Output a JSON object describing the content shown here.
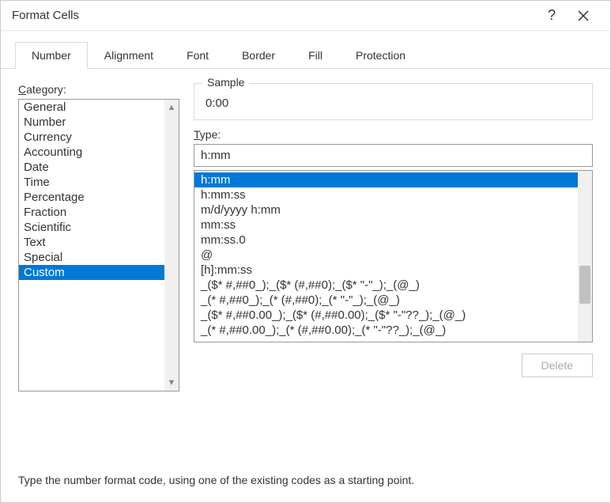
{
  "titlebar": {
    "title": "Format Cells",
    "help": "?"
  },
  "tabs": [
    {
      "label": "Number",
      "active": true
    },
    {
      "label": "Alignment",
      "active": false
    },
    {
      "label": "Font",
      "active": false
    },
    {
      "label": "Border",
      "active": false
    },
    {
      "label": "Fill",
      "active": false
    },
    {
      "label": "Protection",
      "active": false
    }
  ],
  "category": {
    "label_pre": "C",
    "label_post": "ategory:",
    "items": [
      {
        "label": "General",
        "selected": false
      },
      {
        "label": "Number",
        "selected": false
      },
      {
        "label": "Currency",
        "selected": false
      },
      {
        "label": "Accounting",
        "selected": false
      },
      {
        "label": "Date",
        "selected": false
      },
      {
        "label": "Time",
        "selected": false
      },
      {
        "label": "Percentage",
        "selected": false
      },
      {
        "label": "Fraction",
        "selected": false
      },
      {
        "label": "Scientific",
        "selected": false
      },
      {
        "label": "Text",
        "selected": false
      },
      {
        "label": "Special",
        "selected": false
      },
      {
        "label": "Custom",
        "selected": true
      }
    ]
  },
  "sample": {
    "label": "Sample",
    "value": "0:00"
  },
  "type": {
    "label_pre": "T",
    "label_post": "ype:",
    "value": "h:mm",
    "items": [
      {
        "label": "h:mm",
        "selected": true
      },
      {
        "label": "h:mm:ss",
        "selected": false
      },
      {
        "label": "m/d/yyyy h:mm",
        "selected": false
      },
      {
        "label": "mm:ss",
        "selected": false
      },
      {
        "label": "mm:ss.0",
        "selected": false
      },
      {
        "label": "@",
        "selected": false
      },
      {
        "label": "[h]:mm:ss",
        "selected": false
      },
      {
        "label": "_($* #,##0_);_($* (#,##0);_($* \"-\"_);_(@_)",
        "selected": false
      },
      {
        "label": "_(* #,##0_);_(* (#,##0);_(* \"-\"_);_(@_)",
        "selected": false
      },
      {
        "label": "_($* #,##0.00_);_($* (#,##0.00);_($* \"-\"??_);_(@_)",
        "selected": false
      },
      {
        "label": "_(* #,##0.00_);_(* (#,##0.00);_(* \"-\"??_);_(@_)",
        "selected": false
      }
    ]
  },
  "delete_label": "Delete",
  "hint": "Type the number format code, using one of the existing codes as a starting point."
}
